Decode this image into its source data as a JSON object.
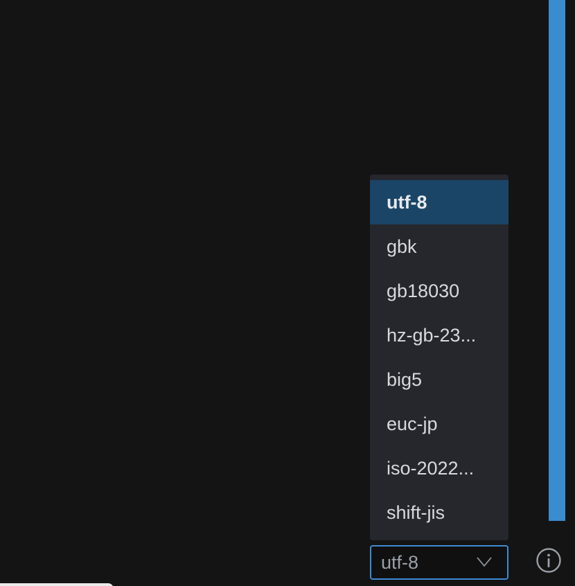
{
  "encoding_dropdown": {
    "options": [
      "utf-8",
      "gbk",
      "gb18030",
      "hz-gb-23...",
      "big5",
      "euc-jp",
      "iso-2022...",
      "shift-jis"
    ],
    "selected_index": 0
  },
  "encoding_select": {
    "value": "utf-8",
    "chevron_icon": "chevron-down-icon"
  },
  "info_button": {
    "icon": "info-icon"
  },
  "colors": {
    "accent": "#3b8bd0",
    "selected_option_bg": "#1a4566",
    "dropdown_bg": "#25272c",
    "background": "#141414"
  }
}
